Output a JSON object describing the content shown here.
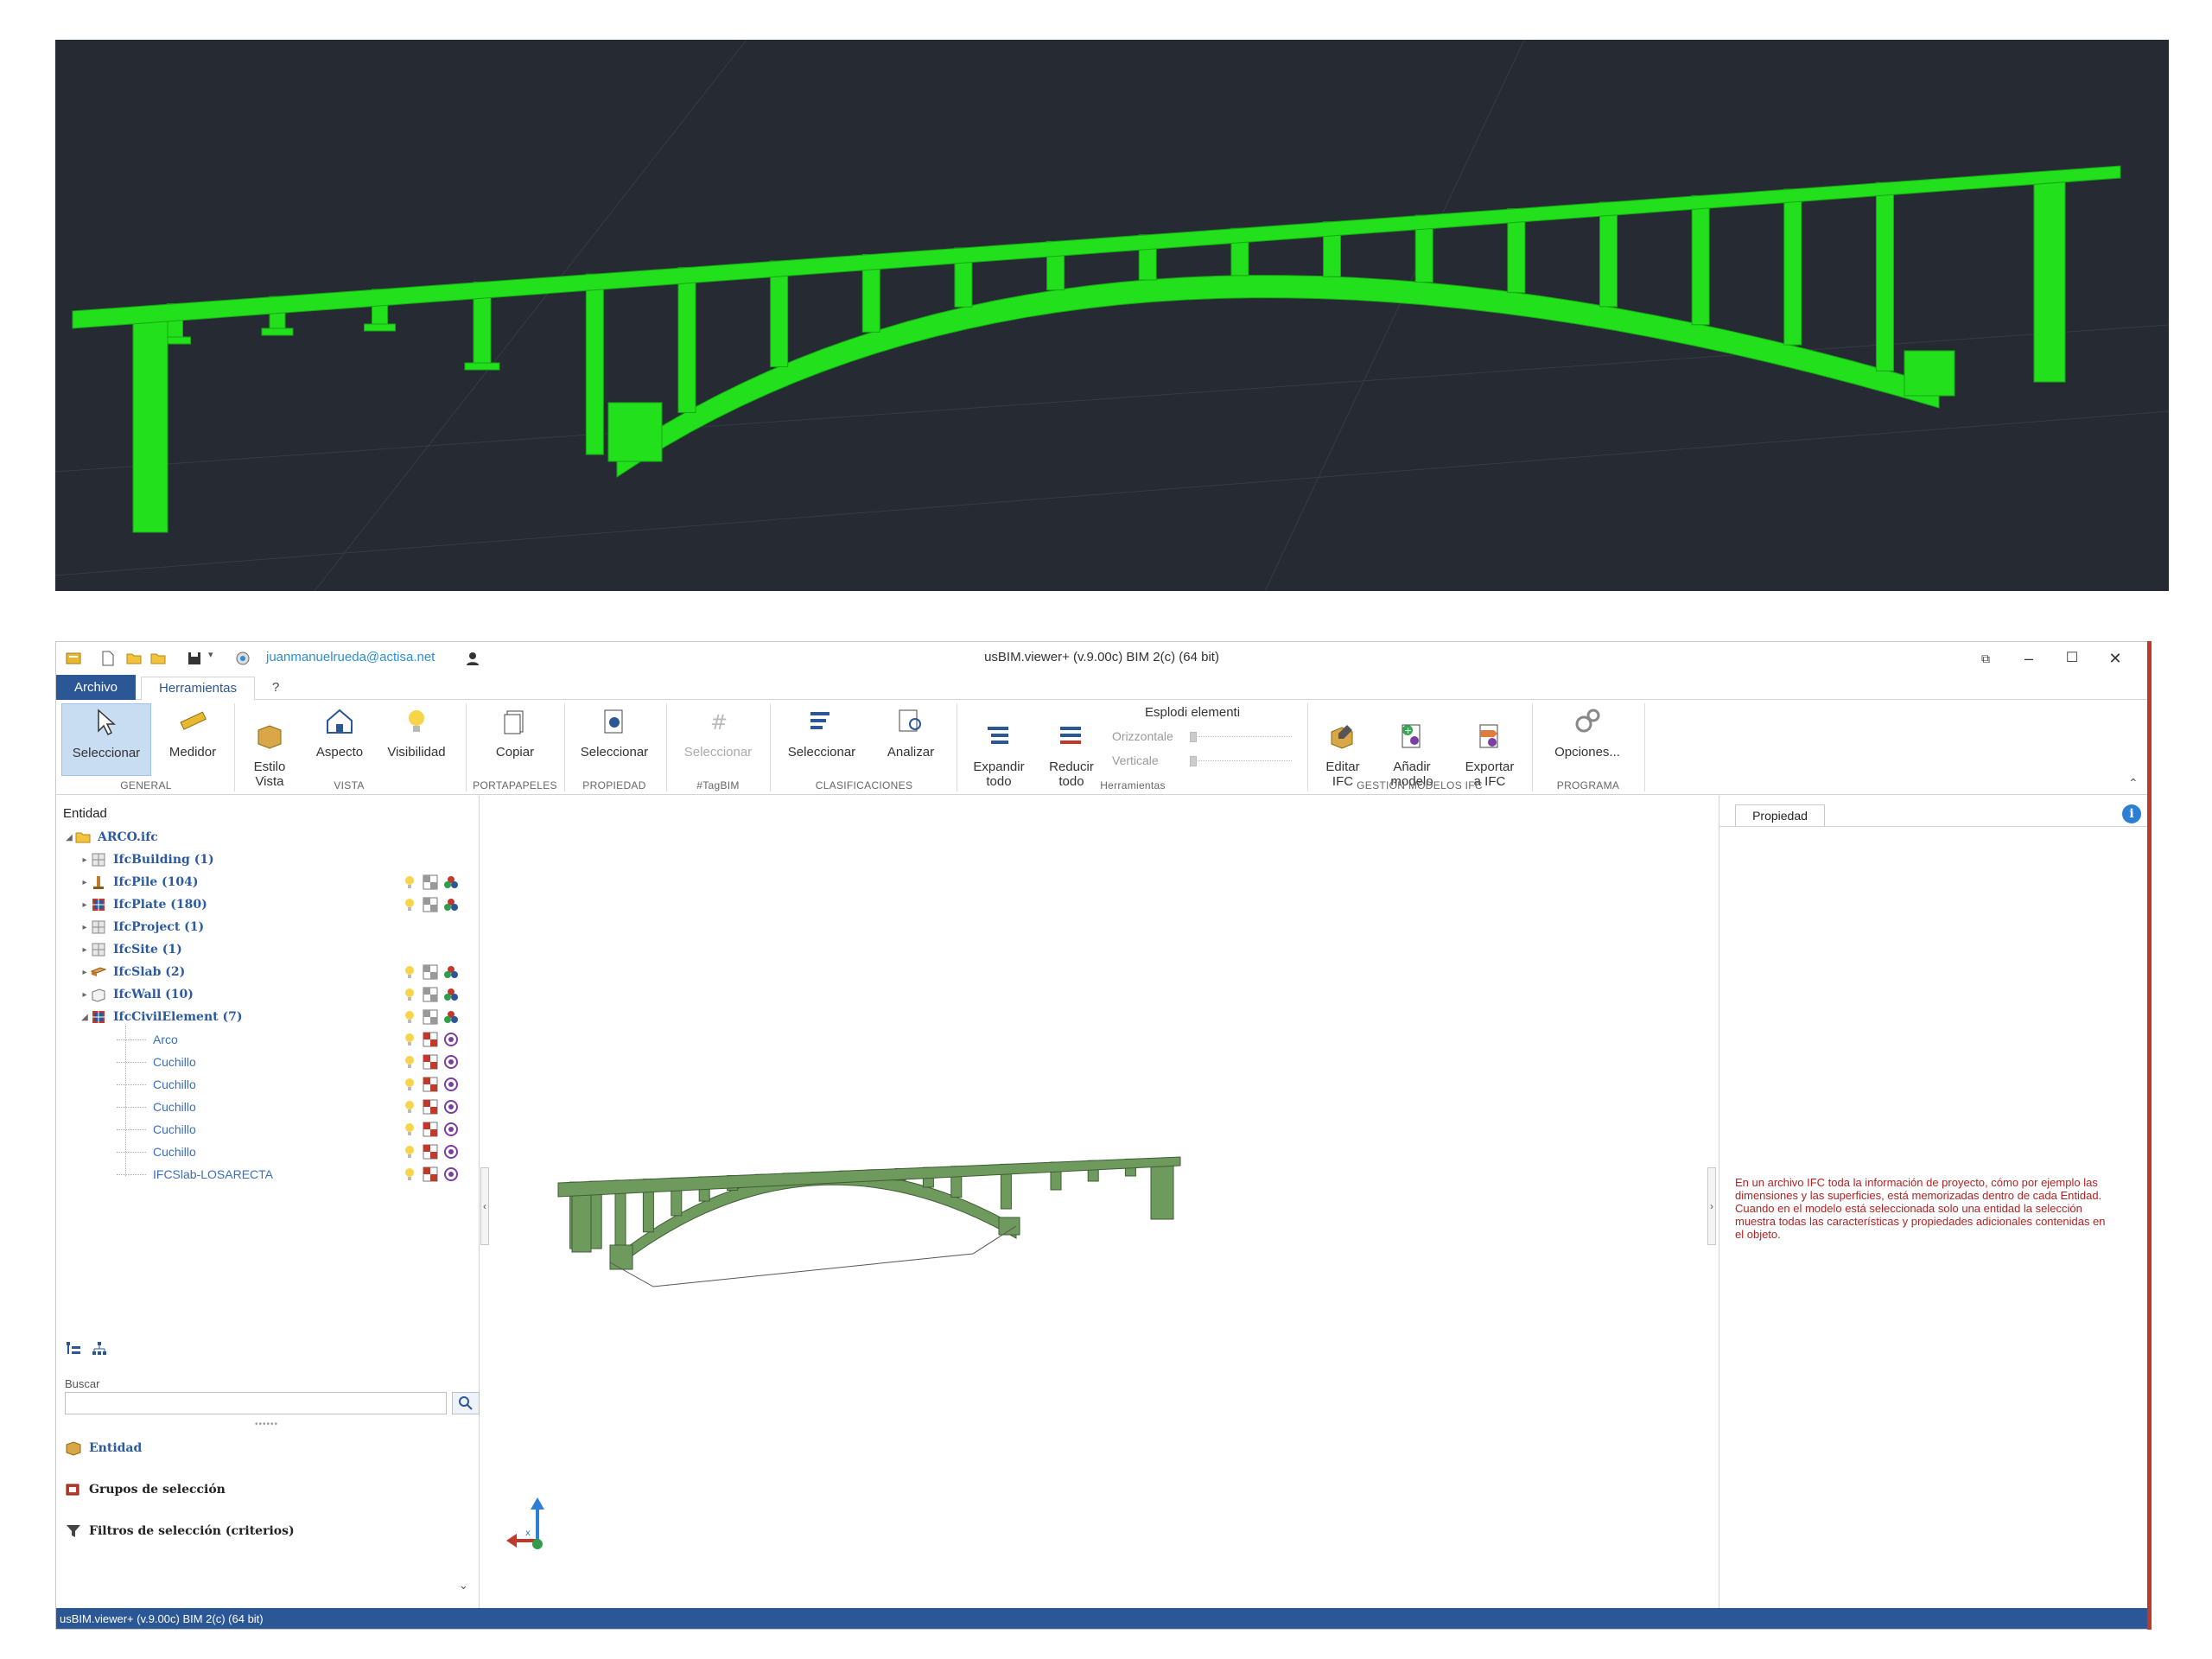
{
  "app": {
    "title": "usBIM.viewer+ (v.9.00c)  BIM 2(c) (64 bit)",
    "user_email": "juanmanuelrueda@actisa.net",
    "status_text": "usBIM.viewer+ (v.9.00c)  BIM 2(c) (64 bit)"
  },
  "tabs": {
    "archivo": "Archivo",
    "herramientas": "Herramientas",
    "help": "?"
  },
  "ribbon": {
    "seleccionar": "Seleccionar",
    "medidor": "Medidor",
    "estilo_vista": "Estilo\nVista",
    "aspecto": "Aspecto",
    "visibilidad": "Visibilidad",
    "copiar": "Copiar",
    "seleccionar_prop": "Seleccionar",
    "seleccionar_tag": "Seleccionar",
    "seleccionar_clas": "Seleccionar",
    "analizar": "Analizar",
    "expandir_todo": "Expandir\ntodo",
    "reducir_todo": "Reducir\ntodo",
    "esplodi_title": "Esplodi elementi",
    "orizzontale": "Orizzontale",
    "verticale": "Verticale",
    "editar_ifc": "Editar\nIFC",
    "anadir_modelo": "Añadir\nmodelo",
    "exportar_ifc": "Exportar\na IFC",
    "opciones": "Opciones...",
    "groups": {
      "general": "GENERAL",
      "vista": "VISTA",
      "portapapeles": "PORTAPAPELES",
      "propiedad": "PROPIEDAD",
      "tagbim": "#TagBIM",
      "clasificaciones": "CLASIFICACIONES",
      "herramientas": "Herramientas",
      "gestion": "GESTIÓN MODELOS IFC",
      "programa": "PROGRAMA"
    }
  },
  "left_panel": {
    "title": "Entidad",
    "root": "ARCO.ifc",
    "tree": [
      {
        "label": "IfcBuilding (1)",
        "icon": "building-icon"
      },
      {
        "label": "IfcPile (104)",
        "icon": "pile-icon"
      },
      {
        "label": "IfcPlate (180)",
        "icon": "plate-icon"
      },
      {
        "label": "IfcProject (1)",
        "icon": "project-icon"
      },
      {
        "label": "IfcSite (1)",
        "icon": "site-icon"
      },
      {
        "label": "IfcSlab (2)",
        "icon": "slab-icon"
      },
      {
        "label": "IfcWall (10)",
        "icon": "wall-icon"
      },
      {
        "label": "IfcCivilElement (7)",
        "icon": "civil-element-icon"
      }
    ],
    "children": [
      "Arco",
      "Cuchillo",
      "Cuchillo",
      "Cuchillo",
      "Cuchillo",
      "Cuchillo",
      "IFCSlab-LOSARECTA"
    ],
    "search_label": "Buscar",
    "search_value": "",
    "accordion": {
      "entidad": "Entidad",
      "grupos": "Grupos de selección",
      "filtros": "Filtros de selección (criterios)"
    }
  },
  "right_panel": {
    "tab": "Propiedad",
    "info_icon": "i",
    "description": "En un archivo IFC toda la información de proyecto, cómo por ejemplo las dimensiones y las superficies, está memorizadas dentro de cada Entidad.\nCuando en el modelo está seleccionada solo una entidad la selección muestra todas las características y propiedades adicionales contenidas en el objeto."
  },
  "colors": {
    "bridge_top": "#22e01b",
    "bridge_viewer": "#6f9a5e",
    "accent": "#2b5797",
    "dark_bg": "#262b33"
  }
}
